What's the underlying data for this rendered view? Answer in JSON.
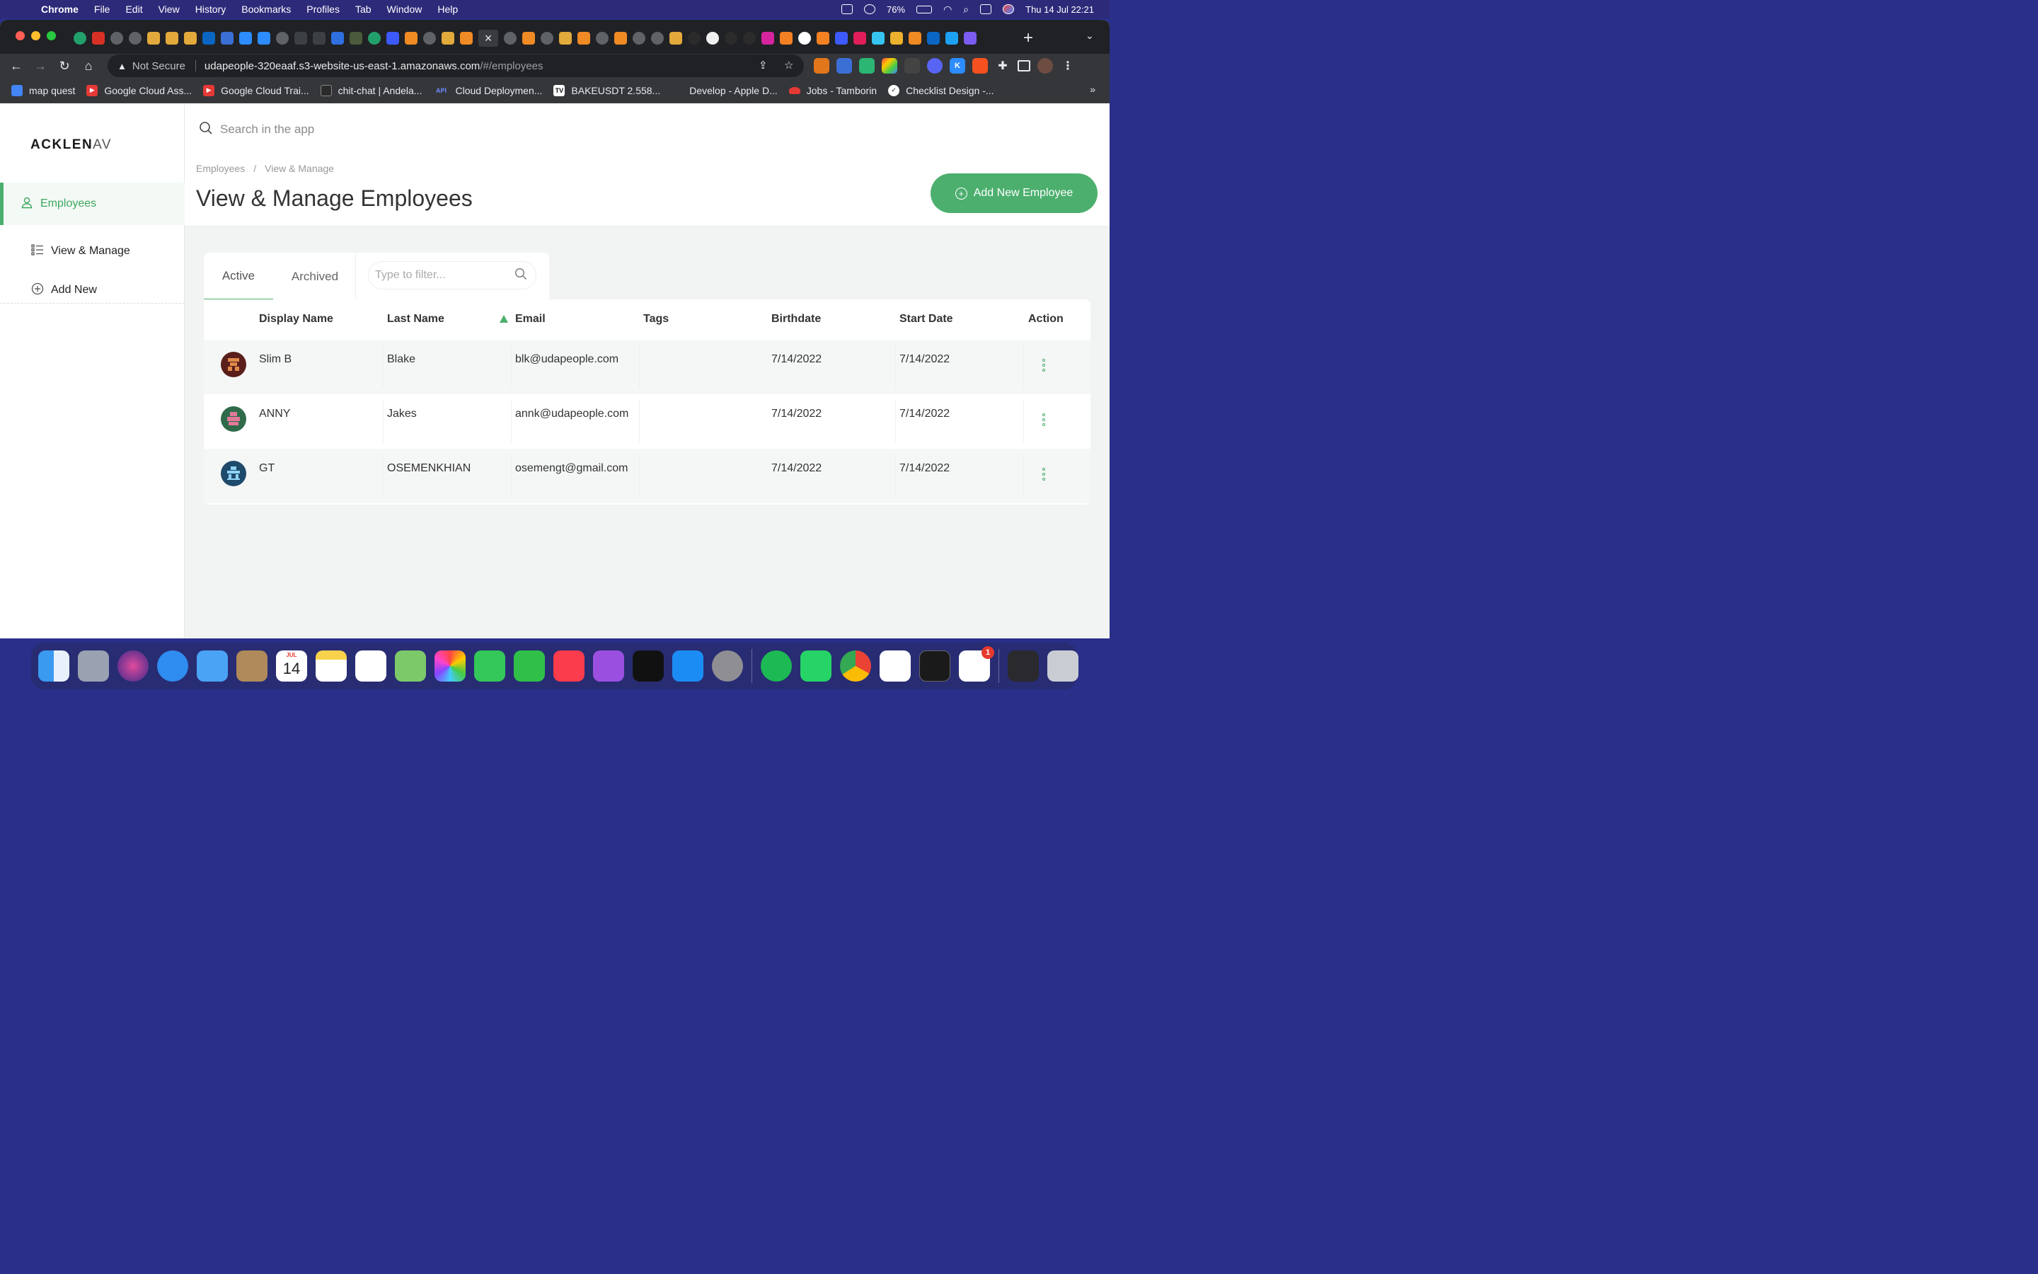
{
  "menubar": {
    "app_name": "Chrome",
    "items": [
      "File",
      "Edit",
      "View",
      "History",
      "Bookmarks",
      "Profiles",
      "Tab",
      "Window",
      "Help"
    ],
    "battery": "76%",
    "datetime": "Thu 14 Jul  22:21"
  },
  "browser": {
    "close_tab_glyph": "×",
    "new_tab_glyph": "+",
    "security_label": "Not Secure",
    "url_host": "udapeople-320eaaf.s3-website-us-east-1.amazonaws.com",
    "url_path": "/#/employees",
    "bookmarks": [
      {
        "label": "map quest",
        "color": "#4285f4"
      },
      {
        "label": "Google Cloud Ass...",
        "color": "#e53935"
      },
      {
        "label": "Google Cloud Trai...",
        "color": "#e53935"
      },
      {
        "label": "chit-chat | Andela...",
        "color": "#2b2b2b"
      },
      {
        "label": "Cloud Deploymen...",
        "color": "#3d5afe"
      },
      {
        "label": "BAKEUSDT 2.558...",
        "color": "#111111"
      },
      {
        "label": "Develop - Apple D...",
        "color": "#9e9e9e"
      },
      {
        "label": "Jobs - Tamborin",
        "color": "#e53935"
      },
      {
        "label": "Checklist Design -...",
        "color": "#ffffff"
      }
    ],
    "more_bookmarks": "»"
  },
  "sidebar": {
    "logo_bold": "ACKLEN",
    "logo_thin": "AV",
    "section": "Employees",
    "items": [
      {
        "label": "View & Manage"
      },
      {
        "label": "Add New"
      }
    ]
  },
  "search": {
    "placeholder": "Search in the app"
  },
  "header": {
    "breadcrumb": [
      "Employees",
      "View & Manage"
    ],
    "title": "View & Manage Employees",
    "add_button": "Add New Employee"
  },
  "tabs": {
    "active": "Active",
    "archived": "Archived",
    "filter_placeholder": "Type to filter..."
  },
  "table": {
    "columns": [
      "Display Name",
      "Last Name",
      "Email",
      "Tags",
      "Birthdate",
      "Start Date",
      "Action"
    ],
    "rows": [
      {
        "display_name": "Slim B",
        "last_name": "Blake",
        "email": "blk@udapeople.com",
        "tags": "",
        "birthdate": "7/14/2022",
        "start_date": "7/14/2022",
        "avatar_color": "#5a1f1a"
      },
      {
        "display_name": "ANNY",
        "last_name": "Jakes",
        "email": "annk@udapeople.com",
        "tags": "",
        "birthdate": "7/14/2022",
        "start_date": "7/14/2022",
        "avatar_color": "#2f6b4a"
      },
      {
        "display_name": "GT",
        "last_name": "OSEMENKHIAN",
        "email": "osemengt@gmail.com",
        "tags": "",
        "birthdate": "7/14/2022",
        "start_date": "7/14/2022",
        "avatar_color": "#1e4a6b"
      }
    ]
  },
  "dock": {
    "calendar_month": "JUL",
    "calendar_day": "14",
    "slack_badge": "1"
  },
  "colors": {
    "accent": "#4caf6e",
    "menubar_bg": "#2e2a7a",
    "chrome_dark": "#202124"
  }
}
